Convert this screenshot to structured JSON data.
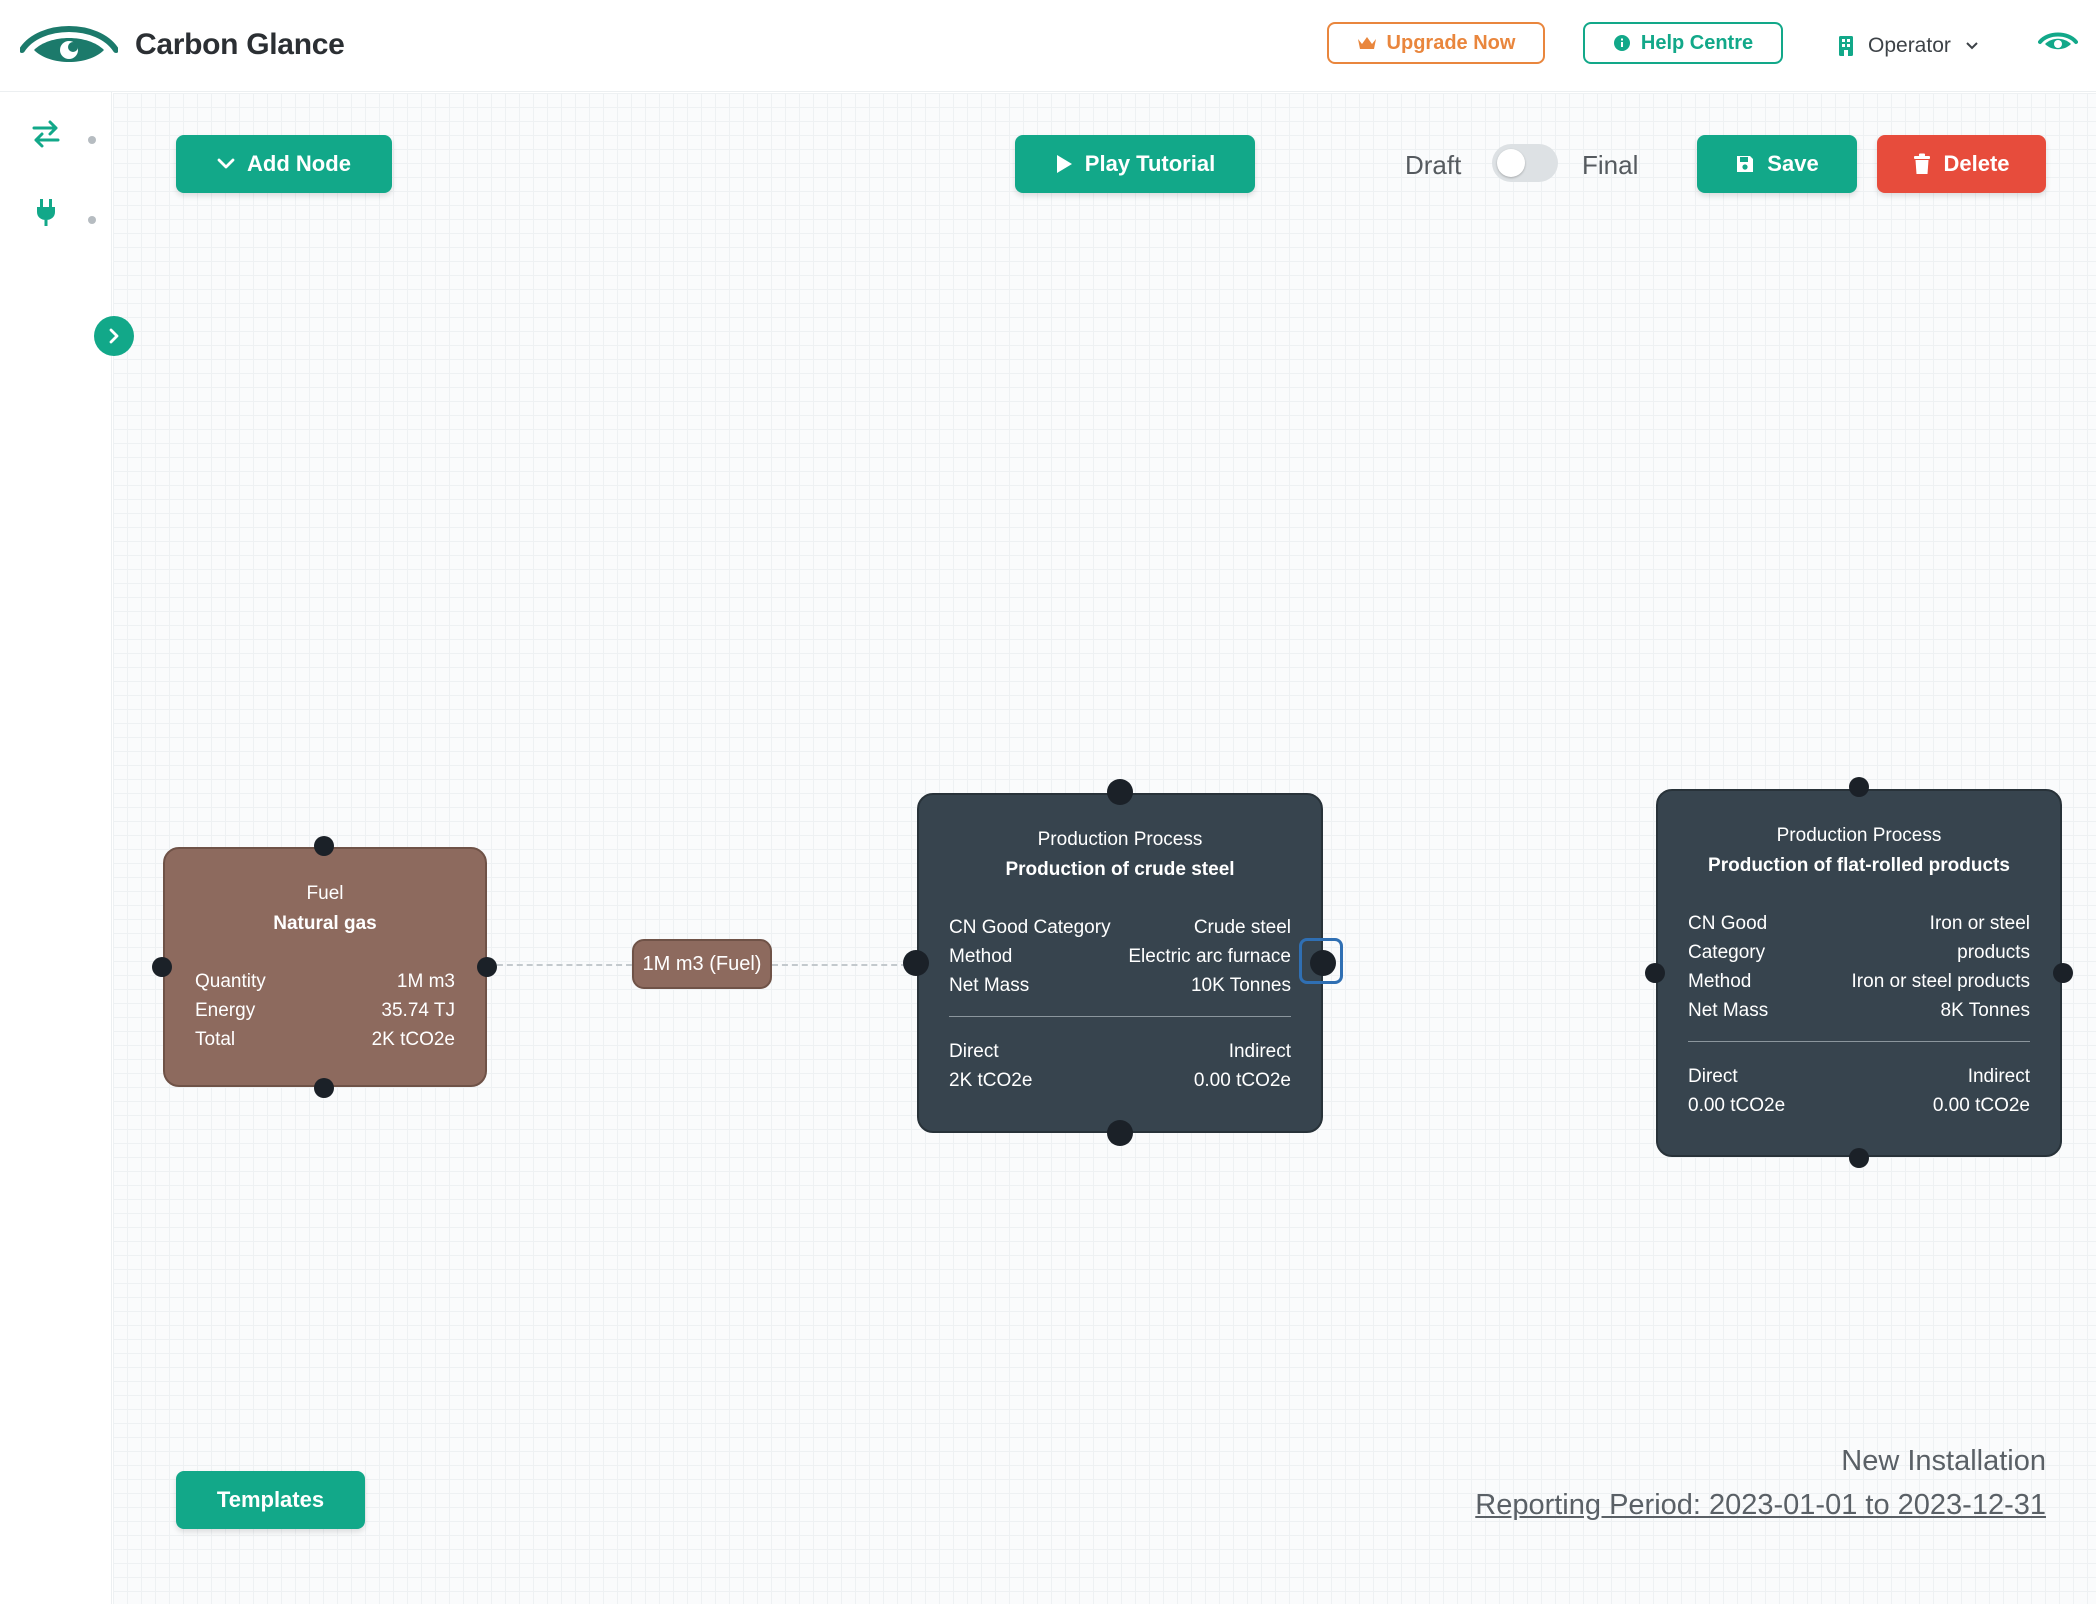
{
  "header": {
    "app_title": "Carbon Glance",
    "upgrade_label": "Upgrade Now",
    "help_label": "Help Centre",
    "operator_label": "Operator"
  },
  "toolbar": {
    "add_node_label": "Add Node",
    "play_tutorial_label": "Play Tutorial",
    "draft_label": "Draft",
    "final_label": "Final",
    "save_label": "Save",
    "delete_label": "Delete",
    "templates_label": "Templates"
  },
  "nodes": {
    "fuel": {
      "title": "Fuel",
      "subtitle": "Natural gas",
      "rows": [
        {
          "label": "Quantity",
          "value": "1M m3"
        },
        {
          "label": "Energy",
          "value": "35.74 TJ"
        },
        {
          "label": "Total",
          "value": "2K tCO2e"
        }
      ]
    },
    "edge": {
      "label": "1M m3 (Fuel)"
    },
    "process1": {
      "title": "Production Process",
      "subtitle": "Production of crude steel",
      "rows": [
        {
          "label": "CN Good Category",
          "value": "Crude steel"
        },
        {
          "label": "Method",
          "value": "Electric arc furnace"
        },
        {
          "label": "Net Mass",
          "value": "10K Tonnes"
        }
      ],
      "direct_label": "Direct",
      "direct_value": "2K tCO2e",
      "indirect_label": "Indirect",
      "indirect_value": "0.00 tCO2e"
    },
    "process2": {
      "title": "Production Process",
      "subtitle": "Production of flat-rolled products",
      "rows": [
        {
          "label": "CN Good Category",
          "value": "Iron or steel products"
        },
        {
          "label": "Method",
          "value": "Iron or steel products"
        },
        {
          "label": "Net Mass",
          "value": "8K Tonnes"
        }
      ],
      "direct_label": "Direct",
      "direct_value": "0.00 tCO2e",
      "indirect_label": "Indirect",
      "indirect_value": "0.00 tCO2e"
    }
  },
  "footer": {
    "installation_name": "New Installation",
    "reporting_period": "Reporting Period: 2023-01-01 to 2023-12-31"
  },
  "colors": {
    "brand": "#12a889",
    "upgrade": "#e9863d",
    "danger": "#e74c3c",
    "fuel_node": "#8d6a5e",
    "process_node": "#37444e"
  },
  "icons": {
    "logo": "eye-logo-icon",
    "upgrade": "crown-icon",
    "help": "info-icon",
    "operator": "building-icon",
    "operator_menu": "chevron-down-icon",
    "visibility": "eye-icon",
    "sidebar_flow": "arrows-swap-icon",
    "sidebar_power": "plug-icon",
    "expand": "chevron-right-icon",
    "add_node": "chevron-down-icon",
    "play": "play-icon",
    "save": "floppy-disk-icon",
    "delete": "trash-icon"
  }
}
